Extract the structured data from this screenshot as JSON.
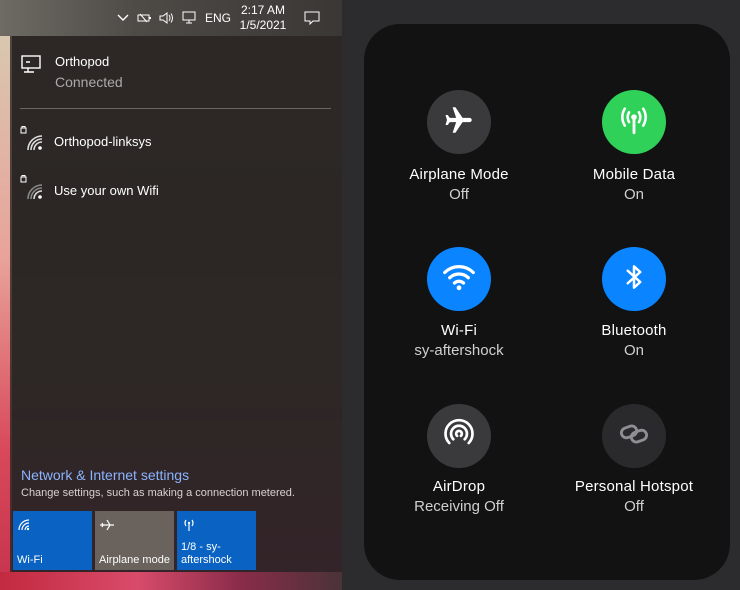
{
  "taskbar": {
    "language": "ENG",
    "time": "2:17 AM",
    "date": "1/5/2021",
    "icons": [
      "chevron-up-icon",
      "battery-icon",
      "volume-icon",
      "network-icon",
      "notification-icon"
    ]
  },
  "windows_flyout": {
    "connected_network": {
      "name": "Orthopod",
      "status": "Connected"
    },
    "networks": [
      {
        "name": "Orthopod-linksys",
        "secured": true
      },
      {
        "name": "Use your own Wifi",
        "secured": true
      }
    ],
    "settings_link": "Network & Internet settings",
    "settings_description": "Change settings, such as making a connection metered.",
    "tiles": [
      {
        "label": "Wi-Fi",
        "active": true,
        "icon": "wifi-icon"
      },
      {
        "label": "Airplane mode",
        "active": false,
        "icon": "airplane-icon"
      },
      {
        "label": "1/8 - sy-\naftershock",
        "active": true,
        "icon": "hotspot-icon"
      }
    ],
    "colors": {
      "tile_active": "#0a63c2",
      "tile_inactive": "#6a625c",
      "link": "#8ab4ff"
    }
  },
  "ios_control_center": {
    "toggles": [
      {
        "label": "Airplane Mode",
        "status": "Off",
        "color": "#3a3a3c",
        "icon": "airplane-icon"
      },
      {
        "label": "Mobile Data",
        "status": "On",
        "color": "#30d158",
        "icon": "antenna-icon"
      },
      {
        "label": "Wi-Fi",
        "status": "sy-aftershock",
        "color": "#0a84ff",
        "icon": "wifi-icon"
      },
      {
        "label": "Bluetooth",
        "status": "On",
        "color": "#0a84ff",
        "icon": "bluetooth-icon"
      },
      {
        "label": "AirDrop",
        "status": "Receiving Off",
        "color": "#3a3a3c",
        "icon": "airdrop-icon"
      },
      {
        "label": "Personal Hotspot",
        "status": "Off",
        "color": "#2a2a2c",
        "icon": "hotspot-link-icon"
      }
    ]
  }
}
